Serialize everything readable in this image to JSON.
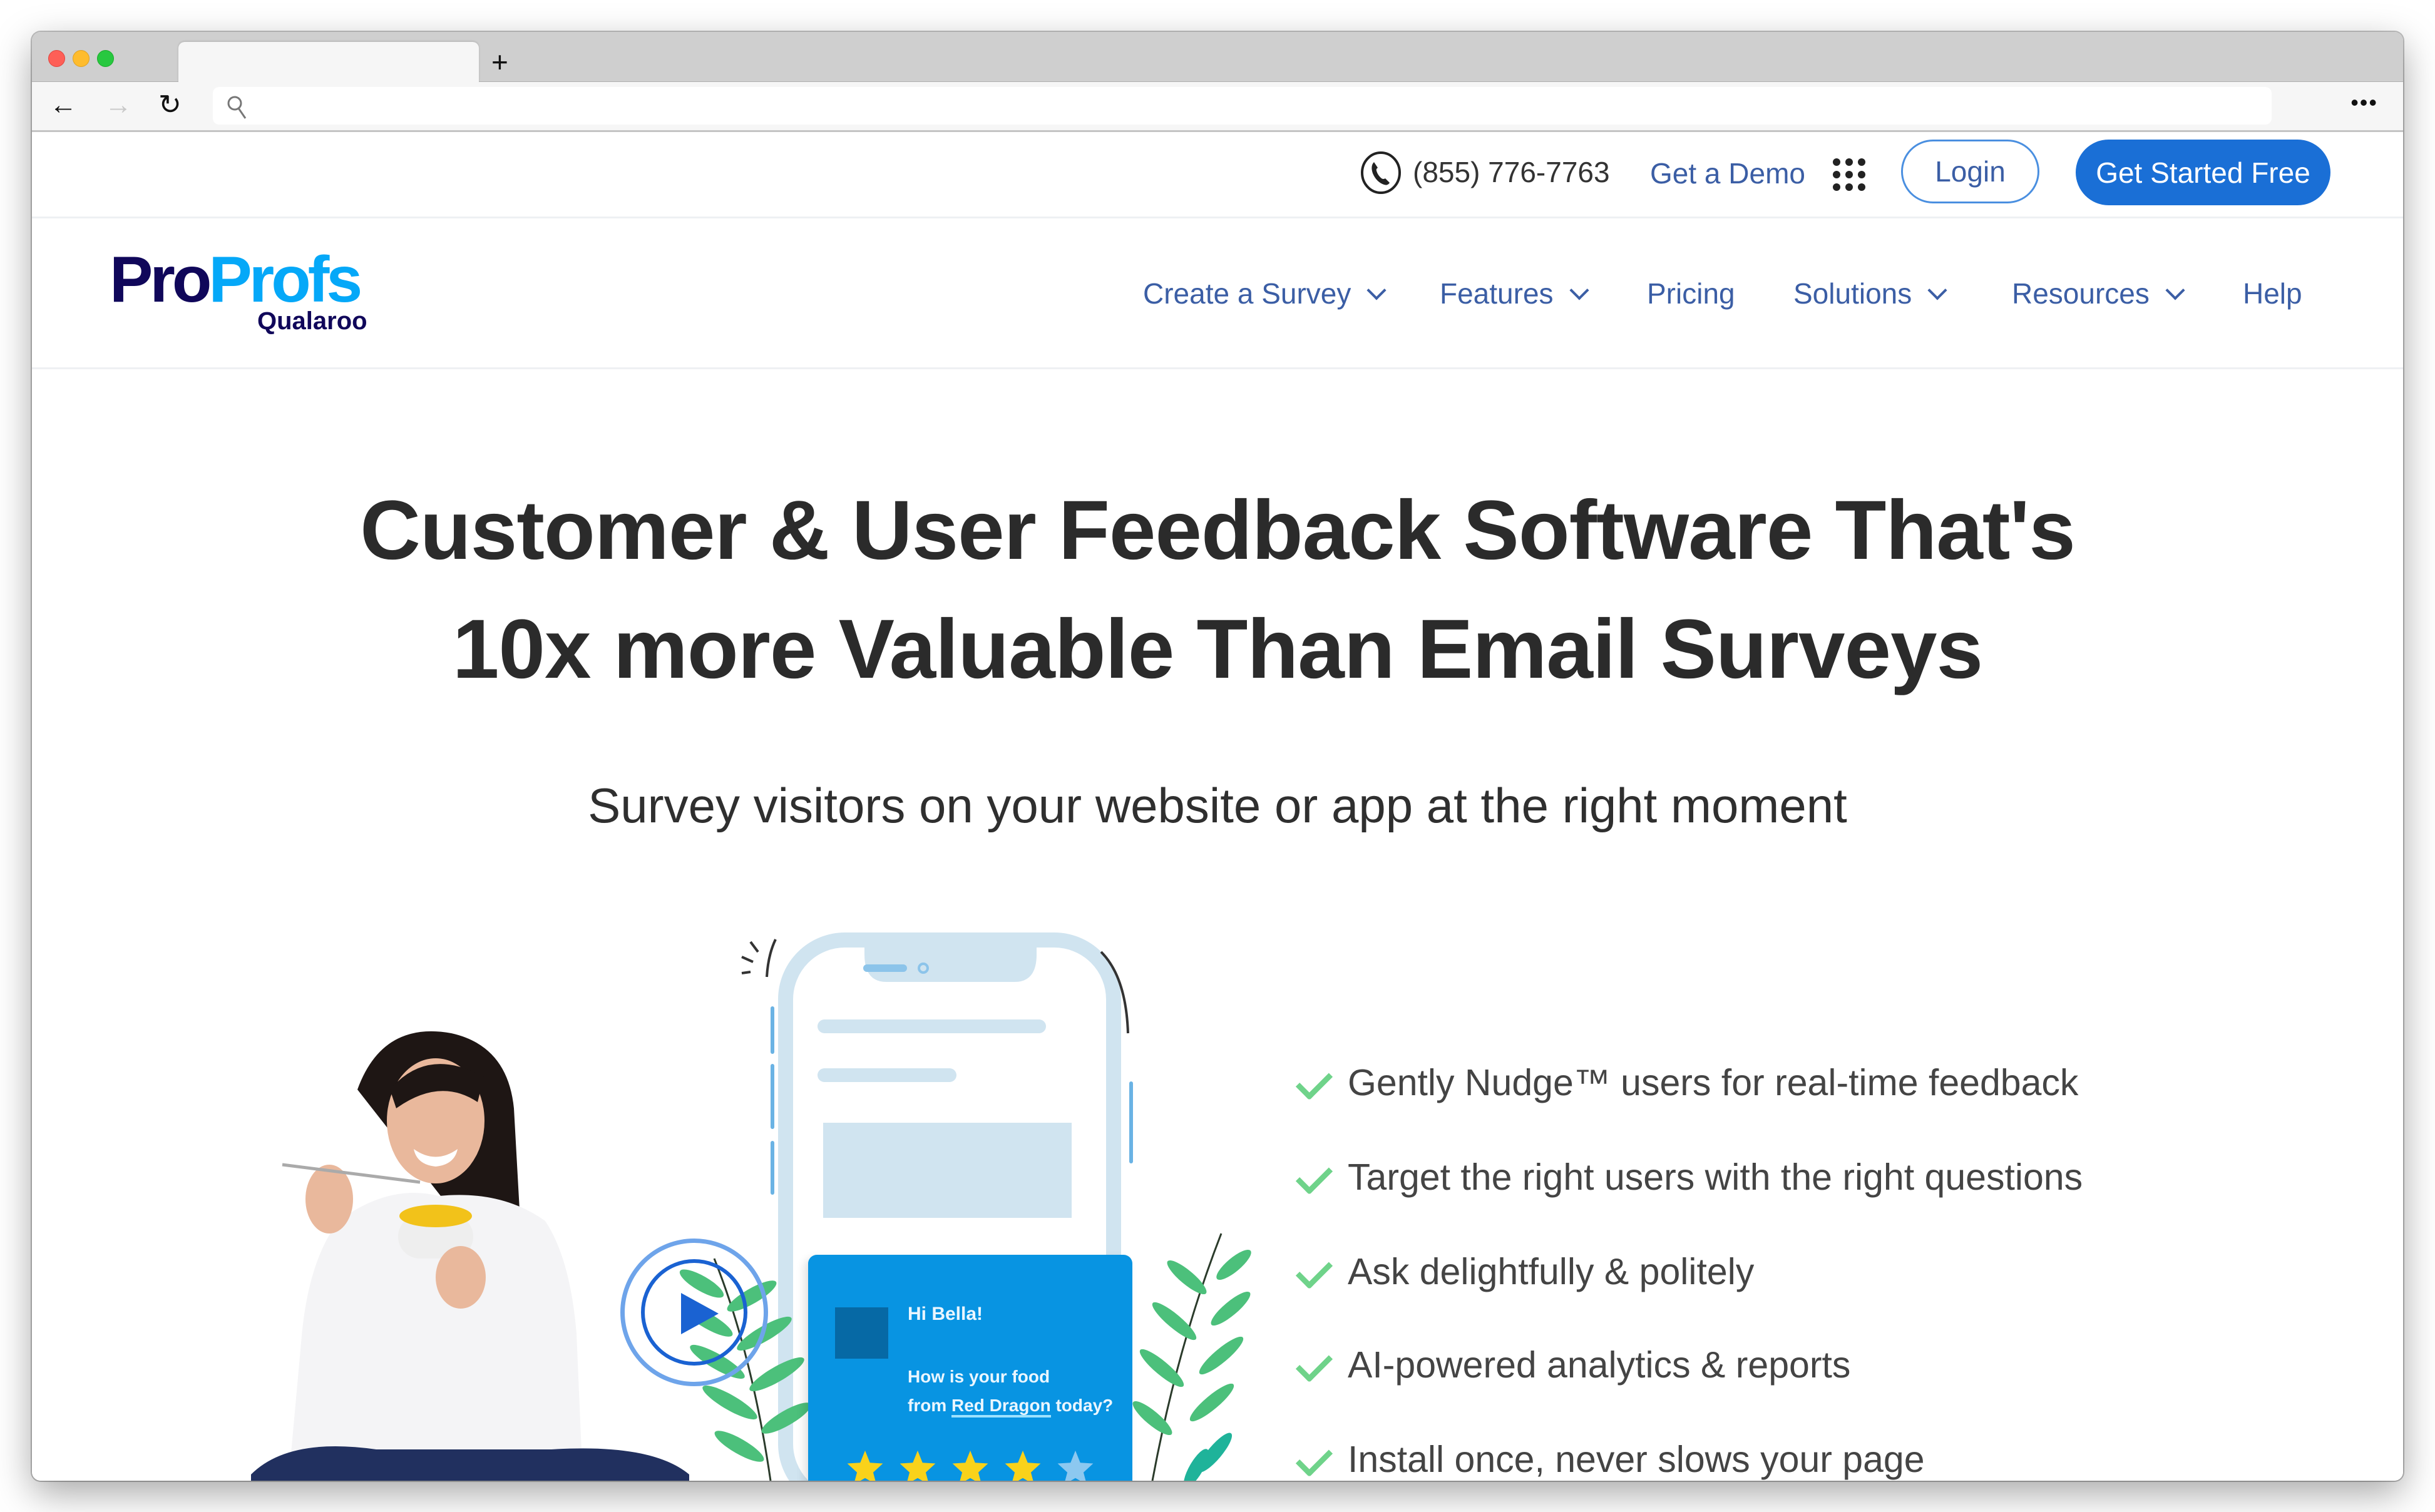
{
  "browser": {
    "tab_title": "",
    "new_tab_label": "+",
    "address_value": "",
    "icons": [
      "back-arrow-icon",
      "forward-arrow-icon",
      "reload-icon",
      "search-icon",
      "more-icon"
    ],
    "back_glyph": "←",
    "forward_glyph": "→",
    "reload_glyph": "↻",
    "more_glyph": "•••"
  },
  "topbar": {
    "phone": "(855) 776-7763",
    "demo_label": "Get a Demo",
    "login_label": "Login",
    "cta_label": "Get Started Free",
    "cta_color": "#1a6fd6"
  },
  "logo": {
    "part1": "Pro",
    "part2": "Profs",
    "sub": "Qualaroo",
    "dark_color": "#10075a",
    "light_color": "#05a8f8"
  },
  "nav": {
    "items": [
      {
        "label": "Create a Survey",
        "has_dropdown": true
      },
      {
        "label": "Features",
        "has_dropdown": true
      },
      {
        "label": "Pricing",
        "has_dropdown": false
      },
      {
        "label": "Solutions",
        "has_dropdown": true
      },
      {
        "label": "Resources",
        "has_dropdown": true
      },
      {
        "label": "Help",
        "has_dropdown": false
      }
    ]
  },
  "hero": {
    "title_line1": "Customer & User Feedback Software That's",
    "title_line2": "10x more Valuable Than Email Surveys",
    "subtitle": "Survey visitors on your website or app at the right moment",
    "features": [
      "Gently Nudge™ users for real-time feedback",
      "Target the right users with the right questions",
      "Ask delightfully & politely",
      "AI-powered analytics & reports",
      "Install once, never slows your page"
    ],
    "check_color": "#6fd38a"
  },
  "illustration": {
    "greeting": "Hi Bella!",
    "question_line1": "How is your food",
    "question_pre": "from ",
    "question_link": "Red Dragon",
    "question_post": " today?",
    "rating": 4,
    "rating_max": 5,
    "card_color": "#0894e2",
    "star_color": "#f9d21a",
    "star_empty_color": "#8cc8f0"
  }
}
